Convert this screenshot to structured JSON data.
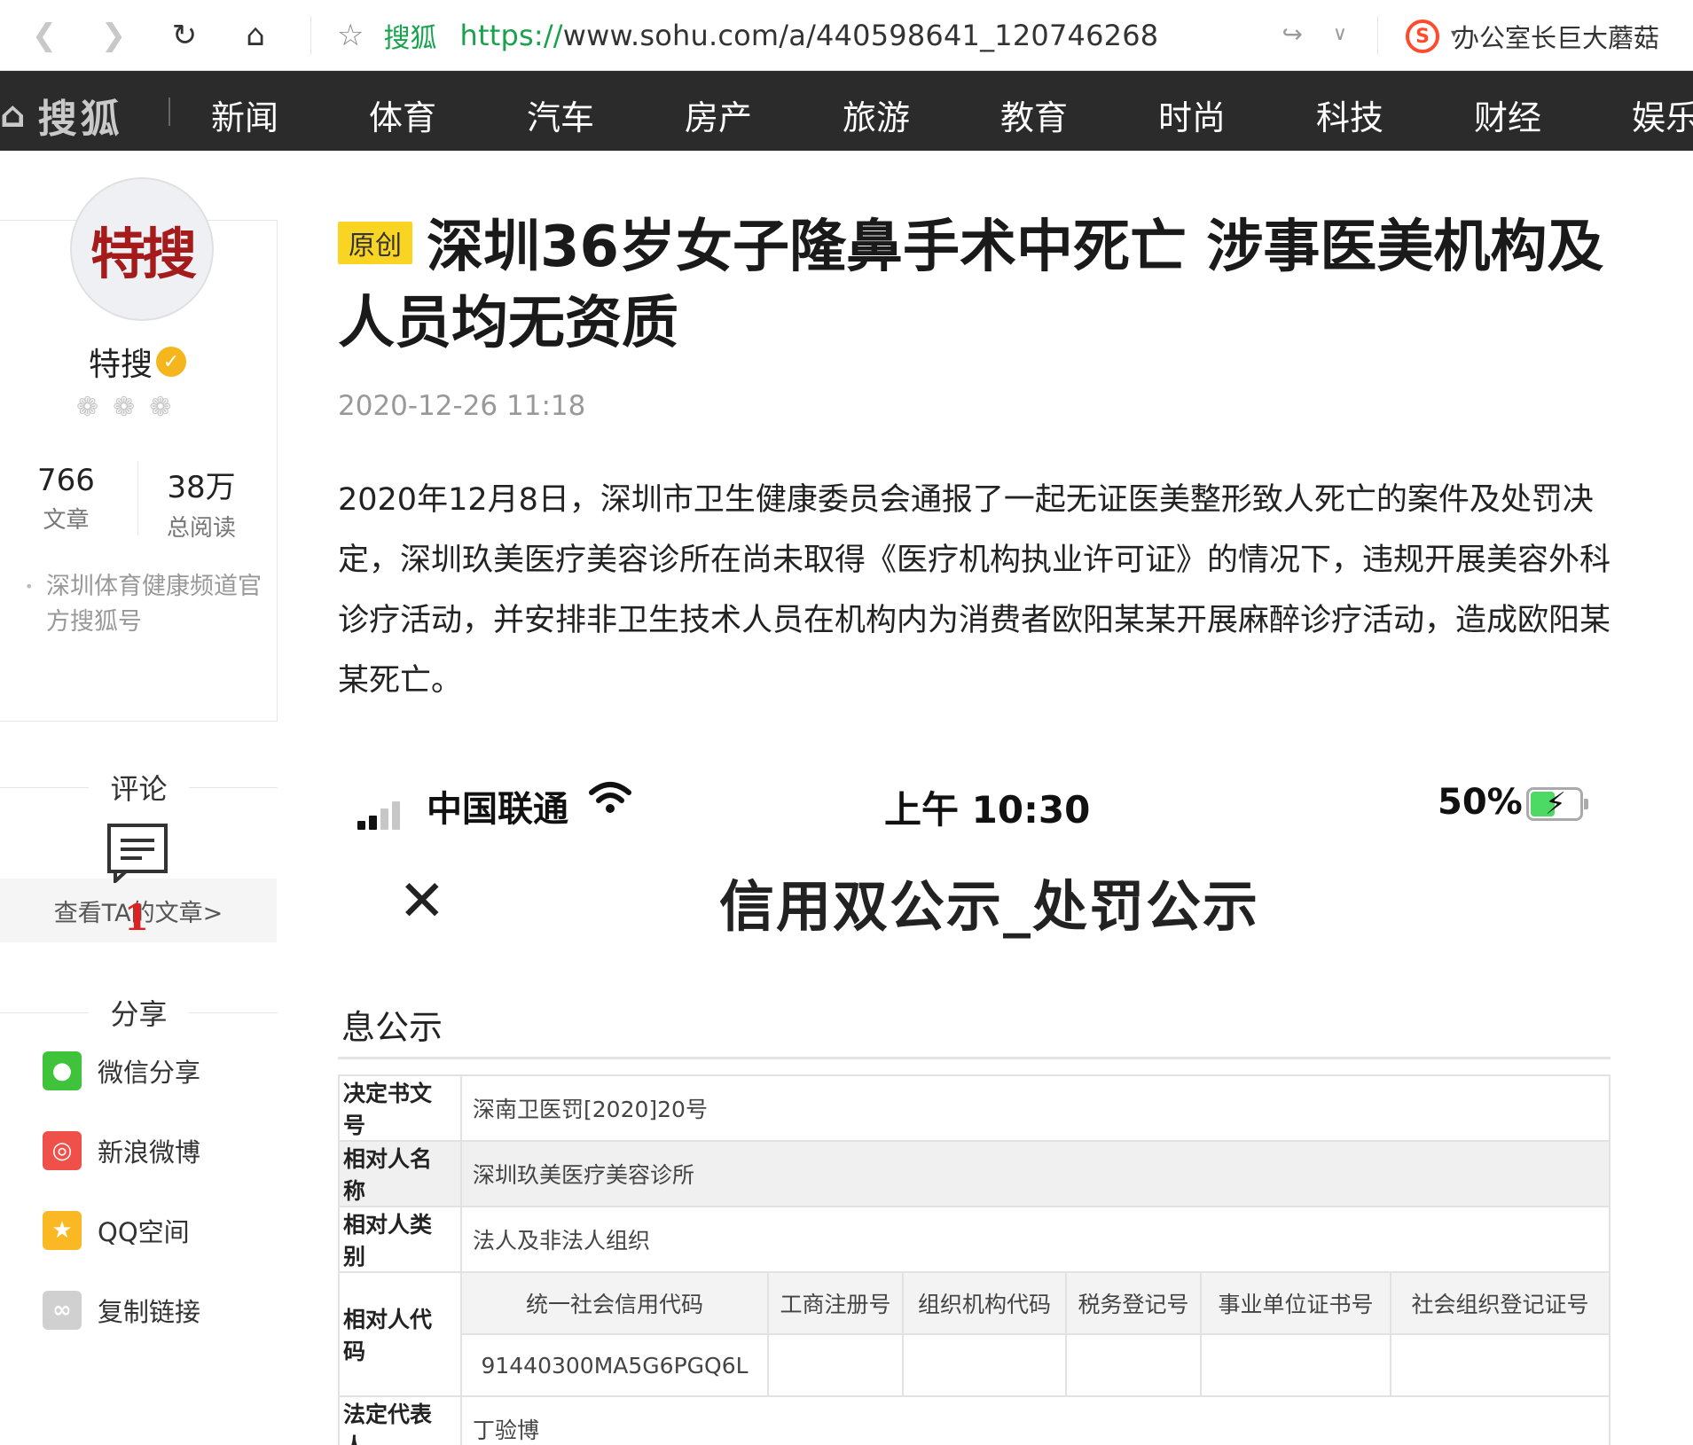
{
  "browser": {
    "back_icon": "chevron-left-icon",
    "forward_icon": "chevron-right-icon",
    "reload_icon": "reload-icon",
    "home_icon": "home-icon",
    "site_name": "搜狐",
    "url_protocol": "https://",
    "url_rest": "www.sohu.com/a/440598641_120746268",
    "user_label": "办公室长巨大蘑菇"
  },
  "site_nav": {
    "logo": "搜狐",
    "items": [
      "新闻",
      "体育",
      "汽车",
      "房产",
      "旅游",
      "教育",
      "时尚",
      "科技",
      "财经",
      "娱乐"
    ]
  },
  "author": {
    "avatar_text": "特搜",
    "name": "特搜",
    "articles_count": "766",
    "articles_label": "文章",
    "reads_count": "38万",
    "reads_label": "总阅读",
    "description": "深圳体育健康频道官方搜狐号",
    "desc_line1": "深圳体育健康频道官",
    "desc_line2": "方搜狐号",
    "view_articles": "查看TA的文章>"
  },
  "comments": {
    "heading": "评论",
    "count": "1"
  },
  "share": {
    "heading": "分享",
    "items": [
      {
        "label": "微信分享",
        "color": "#3fc33a"
      },
      {
        "label": "新浪微博",
        "color": "#f0504a"
      },
      {
        "label": "QQ空间",
        "color": "#f9b824"
      },
      {
        "label": "复制链接",
        "color": "#d0d0d0"
      }
    ]
  },
  "article": {
    "badge": "原创",
    "title": "深圳36岁女子隆鼻手术中死亡 涉事医美机构及人员均无资质",
    "date": "2020-12-26 11:18",
    "body": "2020年12月8日，深圳市卫生健康委员会通报了一起无证医美整形致人死亡的案件及处罚决定，深圳玖美医疗美容诊所在尚未取得《医疗机构执业许可证》的情况下，违规开展美容外科诊疗活动，并安排非卫生技术人员在机构内为消费者欧阳某某开展麻醉诊疗活动，造成欧阳某某死亡。"
  },
  "phone_screenshot": {
    "carrier": "中国联通",
    "time": "上午 10:30",
    "battery": "50%",
    "battery_level": 0.5,
    "page_title": "信用双公示_处罚公示",
    "section": "息公示",
    "rows": {
      "decision_no_label": "决定书文号",
      "decision_no": "深南卫医罚[2020]20号",
      "party_name_label": "相对人名称",
      "party_name": "深圳玖美医疗美容诊所",
      "party_type_label": "相对人类别",
      "party_type": "法人及非法人组织",
      "party_code_label": "相对人代码",
      "code_headers": [
        "统一社会信用代码",
        "工商注册号",
        "组织机构代码",
        "税务登记号",
        "事业单位证书号",
        "社会组织登记证号"
      ],
      "credit_code": "91440300MA5G6PGQ6L",
      "legal_rep_label": "法定代表人",
      "legal_rep": "丁验博"
    }
  }
}
